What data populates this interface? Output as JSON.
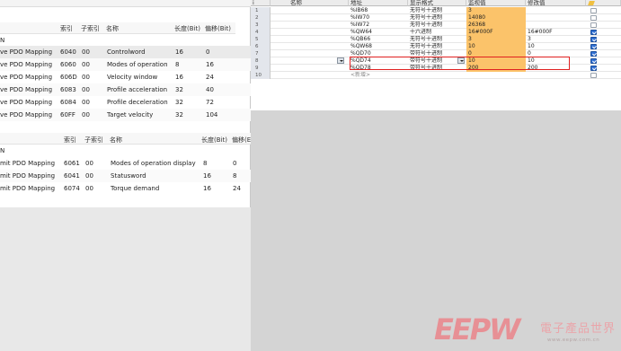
{
  "left": {
    "rx_table": {
      "headers": [
        "索引",
        "子索引",
        "名称",
        "长度(Bit)",
        "偏移(Bit)"
      ],
      "group_label": "N",
      "rows": [
        {
          "pdo": "ve PDO Mapping",
          "index": "6040",
          "sub": "00",
          "name": "Controlword",
          "len": "16",
          "off": "0"
        },
        {
          "pdo": "ve PDO Mapping",
          "index": "6060",
          "sub": "00",
          "name": "Modes of operation",
          "len": "8",
          "off": "16"
        },
        {
          "pdo": "ve PDO Mapping",
          "index": "606D",
          "sub": "00",
          "name": "Velocity window",
          "len": "16",
          "off": "24"
        },
        {
          "pdo": "ve PDO Mapping",
          "index": "6083",
          "sub": "00",
          "name": "Profile acceleration",
          "len": "32",
          "off": "40"
        },
        {
          "pdo": "ve PDO Mapping",
          "index": "6084",
          "sub": "00",
          "name": "Profile deceleration",
          "len": "32",
          "off": "72"
        },
        {
          "pdo": "ve PDO Mapping",
          "index": "60FF",
          "sub": "00",
          "name": "Target velocity",
          "len": "32",
          "off": "104"
        }
      ]
    },
    "tx_table": {
      "headers": [
        "索引",
        "子索引",
        "名称",
        "长度(Bit)",
        "偏移(E"
      ],
      "group_label": "N",
      "rows": [
        {
          "pdo": "mit PDO Mapping",
          "index": "6061",
          "sub": "00",
          "name": "Modes of operation display",
          "len": "8",
          "off": "0"
        },
        {
          "pdo": "mit PDO Mapping",
          "index": "6041",
          "sub": "00",
          "name": "Statusword",
          "len": "16",
          "off": "8"
        },
        {
          "pdo": "mit PDO Mapping",
          "index": "6074",
          "sub": "00",
          "name": "Torque demand",
          "len": "16",
          "off": "24"
        }
      ]
    }
  },
  "watch": {
    "headers": {
      "num": "i",
      "name": "名称",
      "address": "地址",
      "format": "显示格式",
      "monitor": "监视值",
      "modify": "修改值"
    },
    "rows": [
      {
        "n": "1",
        "address": "%IB68",
        "format": "无符号十进制",
        "monitor": "3",
        "modify": "",
        "checked": false
      },
      {
        "n": "2",
        "address": "%IW70",
        "format": "无符号十进制",
        "monitor": "14080",
        "modify": "",
        "checked": false
      },
      {
        "n": "3",
        "address": "%IW72",
        "format": "无符号十进制",
        "monitor": "26368",
        "modify": "",
        "checked": false
      },
      {
        "n": "4",
        "address": "%QW64",
        "format": "十六进制",
        "monitor": "16#000F",
        "modify": "16#000F",
        "checked": true
      },
      {
        "n": "5",
        "address": "%QB66",
        "format": "无符号十进制",
        "monitor": "3",
        "modify": "3",
        "checked": true
      },
      {
        "n": "6",
        "address": "%QW68",
        "format": "无符号十进制",
        "monitor": "10",
        "modify": "10",
        "checked": true
      },
      {
        "n": "7",
        "address": "%QD70",
        "format": "带符号十进制",
        "monitor": "0",
        "modify": "0",
        "checked": true
      },
      {
        "n": "8",
        "address": "%QD74",
        "format": "带符号十进制",
        "monitor": "10",
        "modify": "10",
        "checked": true
      },
      {
        "n": "9",
        "address": "%QD78",
        "format": "带符号十进制",
        "monitor": "200",
        "modify": "200",
        "checked": true
      },
      {
        "n": "10",
        "address": "<新增>",
        "format": "",
        "monitor": "",
        "modify": "",
        "checked": false
      }
    ]
  },
  "watermark": {
    "logo": "EEPW",
    "cn": "電子產品世界",
    "url": "www.eepw.com.cn"
  },
  "colors": {
    "monitor_bg": "#fbc36a",
    "highlight": "#e02020",
    "checkbox": "#2f6fd2"
  }
}
